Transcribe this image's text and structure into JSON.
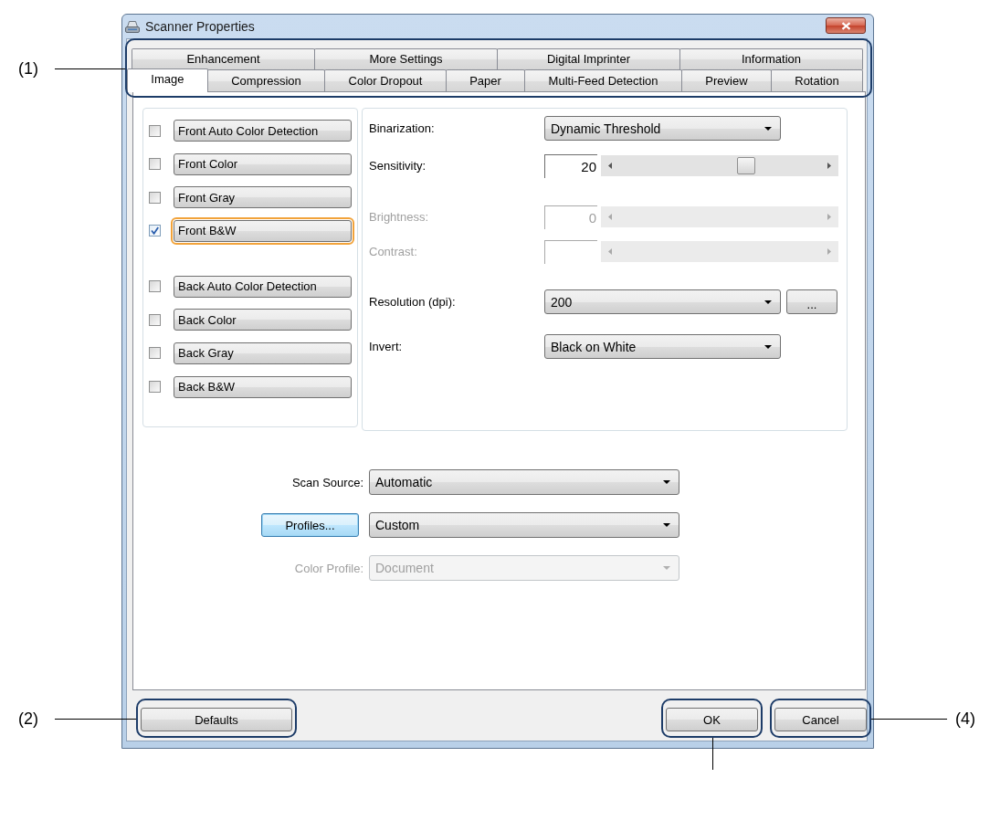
{
  "window": {
    "title": "Scanner Properties"
  },
  "tab_strip": {
    "framed": true,
    "callout_label": "(1)",
    "rows": [
      {
        "tabs": [
          {
            "label": "Enhancement",
            "selected": false
          },
          {
            "label": "More Settings",
            "selected": false
          },
          {
            "label": "Digital Imprinter",
            "selected": false
          },
          {
            "label": "Information",
            "selected": false
          }
        ]
      },
      {
        "tabs": [
          {
            "label": "Image",
            "selected": true
          },
          {
            "label": "Compression",
            "selected": false
          },
          {
            "label": "Color Dropout",
            "selected": false
          },
          {
            "label": "Paper",
            "selected": false
          },
          {
            "label": "Multi-Feed Detection",
            "selected": false
          },
          {
            "label": "Preview",
            "selected": false
          },
          {
            "label": "Rotation",
            "selected": false
          }
        ]
      }
    ]
  },
  "image_types": [
    {
      "items": [
        {
          "label": "Front Auto Color Detection",
          "checked": false,
          "selected": false
        },
        {
          "label": "Front Color",
          "checked": false,
          "selected": false
        },
        {
          "label": "Front Gray",
          "checked": false,
          "selected": false
        },
        {
          "label": "Front B&W",
          "checked": true,
          "selected": true
        }
      ]
    },
    {
      "items": [
        {
          "label": "Back Auto Color Detection",
          "checked": false,
          "selected": false
        },
        {
          "label": "Back Color",
          "checked": false,
          "selected": false
        },
        {
          "label": "Back Gray",
          "checked": false,
          "selected": false
        },
        {
          "label": "Back B&W",
          "checked": false,
          "selected": false
        }
      ]
    }
  ],
  "settings": [
    {
      "kind": "dropdown",
      "label": "Binarization:",
      "value": "Dynamic Threshold",
      "disabled": false
    },
    {
      "kind": "slider",
      "label": "Sensitivity:",
      "value": "20",
      "level": 0.64,
      "disabled": false
    },
    {
      "kind": "slider",
      "label": "Brightness:",
      "value": "0",
      "disabled": true
    },
    {
      "kind": "slider",
      "label": "Contrast:",
      "disabled": true
    },
    {
      "kind": "dropdown",
      "label": "Resolution (dpi):",
      "value": "200",
      "button": "...",
      "disabled": false
    },
    {
      "kind": "dropdown",
      "label": "Invert:",
      "value": "Black on White",
      "disabled": false
    }
  ],
  "source": [
    {
      "kind": "label",
      "label": "Scan Source:",
      "value": "Automatic",
      "disabled": false
    },
    {
      "kind": "button",
      "button": "Profiles...",
      "focused": true,
      "value": "Custom",
      "disabled": false
    },
    {
      "kind": "label",
      "label": "Color Profile:",
      "value": "Document",
      "disabled": true
    }
  ],
  "footer": {
    "left": [
      {
        "label": "Defaults",
        "framed": true,
        "callout_label": "(2)"
      }
    ],
    "right": [
      {
        "label": "OK",
        "framed": true
      },
      {
        "label": "Cancel",
        "framed": true,
        "callout_label": "(4)"
      }
    ]
  }
}
